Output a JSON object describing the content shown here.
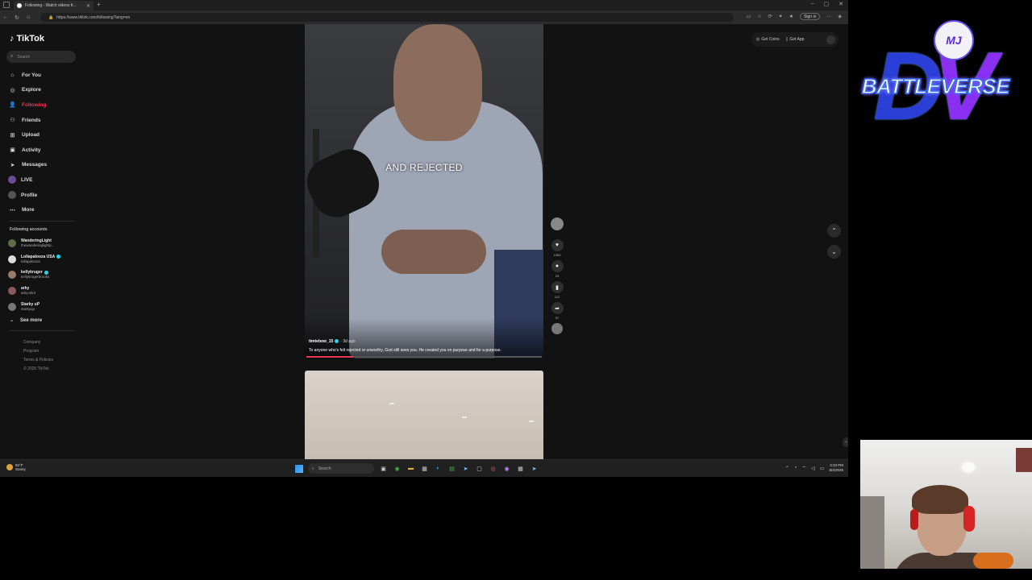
{
  "browser": {
    "tab_title": "Following - Watch videos fr...",
    "url": "https://www.tiktok.com/following?lang=en",
    "signin_label": "Sign in"
  },
  "tiktok": {
    "logo": "TikTok",
    "search_placeholder": "Search",
    "nav": [
      {
        "label": "For You",
        "icon": "home-icon"
      },
      {
        "label": "Explore",
        "icon": "compass-icon"
      },
      {
        "label": "Following",
        "icon": "users-icon",
        "active": true
      },
      {
        "label": "Friends",
        "icon": "friends-icon"
      },
      {
        "label": "Upload",
        "icon": "plus-square-icon"
      },
      {
        "label": "Activity",
        "icon": "inbox-icon"
      },
      {
        "label": "Messages",
        "icon": "send-icon"
      },
      {
        "label": "LIVE",
        "icon": "live-icon"
      },
      {
        "label": "Profile",
        "icon": "profile-icon"
      },
      {
        "label": "More",
        "icon": "more-icon"
      }
    ],
    "following_heading": "Following accounts",
    "accounts": [
      {
        "name": "WanderingLight",
        "handle": "thewanderinglightp..."
      },
      {
        "name": "Lollapalooza USA",
        "handle": "lollapalooza",
        "verified": true
      },
      {
        "name": "kellykruger",
        "handle": "kellykrugerbrooks",
        "verified": true
      },
      {
        "name": "arky",
        "handle": "arky.ark4"
      },
      {
        "name": "Starky uP",
        "handle": "starkyup"
      }
    ],
    "see_more": "See more",
    "footer": [
      "Company",
      "Program",
      "Terms & Policies",
      "© 2025 TikTok"
    ],
    "top_buttons": {
      "coins": "Get Coins",
      "app": "Get App"
    },
    "video": {
      "caption_overlay": "AND REJECTED",
      "author": "timtebow_15",
      "ago": "· 3d ago",
      "description": "To anyone who's felt rejected or unworthy, God still sees you. He created you on purpose and for a purpose.",
      "progress": 0.2
    },
    "actions": {
      "likes": "1393",
      "comments": "23",
      "saves": "112",
      "shares": "97"
    }
  },
  "taskbar": {
    "weather_temp": "82°F",
    "weather_desc": "Sunny",
    "search_placeholder": "Search",
    "time": "3:33 PM",
    "date": "8/4/2025"
  },
  "overlay": {
    "badge_text": "MJ",
    "brand": "BATTLEVERSE",
    "monogram_d": "D",
    "monogram_v": "V"
  }
}
